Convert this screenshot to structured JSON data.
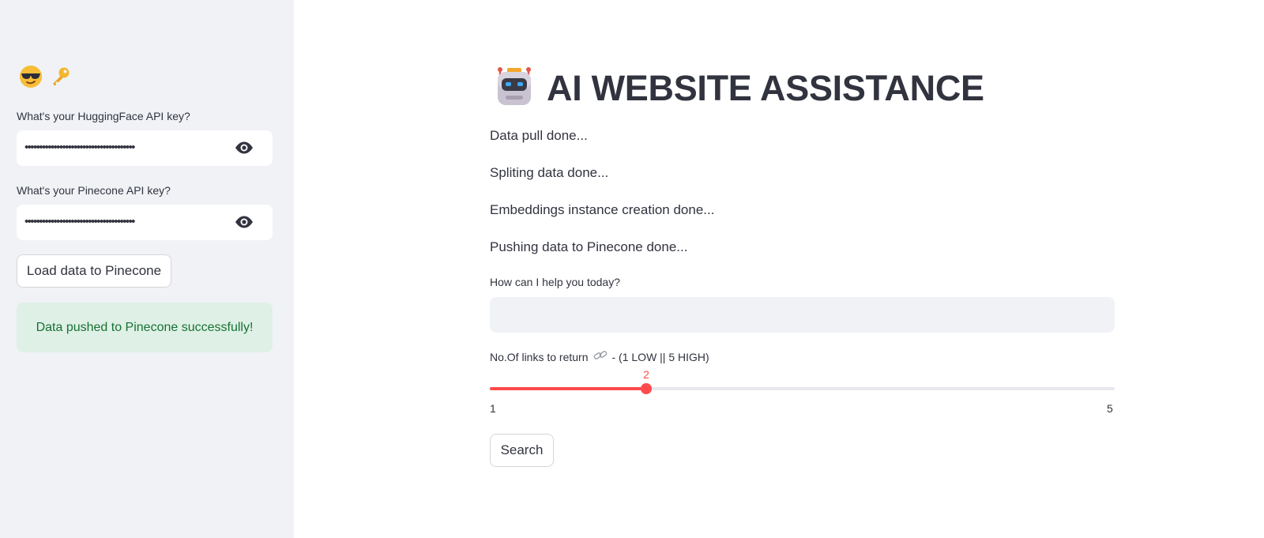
{
  "sidebar": {
    "huggingface_label": "What's your HuggingFace API key?",
    "huggingface_value": "••••••••••••••••••••••••••••••••••••••",
    "pinecone_label": "What's your Pinecone API key?",
    "pinecone_value": "••••••••••••••••••••••••••••••••••••••",
    "load_button": "Load data to Pinecone",
    "success_message": "Data pushed to Pinecone successfully!",
    "icons": [
      "sunglasses-emoji-icon",
      "key-emoji-icon"
    ]
  },
  "main": {
    "title": "AI WEBSITE ASSISTANCE",
    "title_icon": "robot-emoji-icon",
    "status_messages": [
      "Data pull done...",
      "Spliting data done...",
      "Embeddings instance creation done...",
      "Pushing data to Pinecone done..."
    ],
    "question_label": "How can I help you today?",
    "question_value": "",
    "slider": {
      "label_prefix": "No.Of links to return",
      "label_suffix": "- (1 LOW || 5 HIGH)",
      "min": 1,
      "max": 5,
      "value": 2,
      "value_text": "2",
      "min_text": "1",
      "max_text": "5"
    },
    "search_button": "Search"
  },
  "colors": {
    "sidebar_bg": "#f0f2f6",
    "accent": "#ff4b4b",
    "success_bg": "#dff0e6",
    "success_text": "#177233",
    "text": "#31333f"
  }
}
